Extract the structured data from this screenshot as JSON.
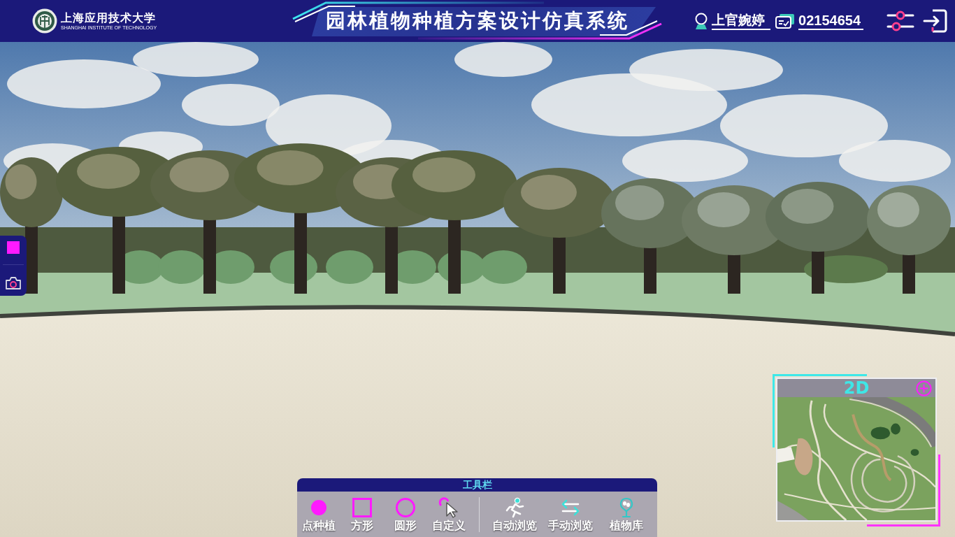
{
  "header": {
    "logo": {
      "name": "上海应用技术大学",
      "english_name": "SHANGHAI INSTITUTE OF TECHNOLOGY"
    },
    "title": "园林植物种植方案设计仿真系统",
    "user": {
      "name": "上官婉婷",
      "student_id": "02154654"
    }
  },
  "toolbar": {
    "title": "工具栏",
    "groups": [
      {
        "tools": [
          {
            "kind": "point",
            "label": "点种植"
          },
          {
            "kind": "square",
            "label": "方形"
          },
          {
            "kind": "circle",
            "label": "圆形"
          },
          {
            "kind": "custom",
            "label": "自定义"
          }
        ]
      },
      {
        "tools": [
          {
            "kind": "auto_tour",
            "label": "自动浏览"
          },
          {
            "kind": "manual_tour",
            "label": "手动浏览"
          },
          {
            "kind": "library",
            "label": "植物库"
          }
        ]
      }
    ]
  },
  "minimap": {
    "mode": "2D"
  }
}
